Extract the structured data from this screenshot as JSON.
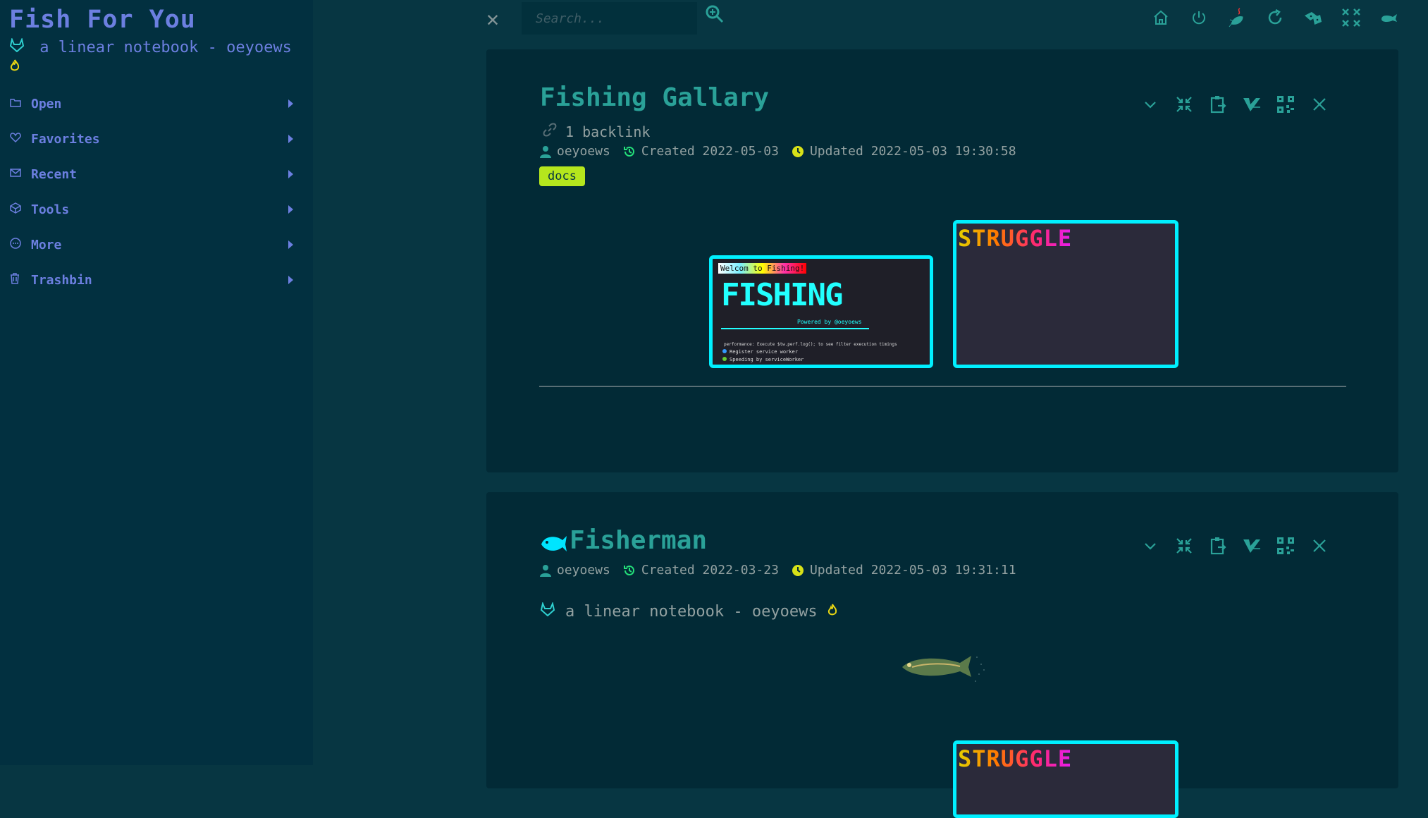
{
  "sidebar": {
    "title": "Fish For You",
    "subtitle": "a linear notebook - oeyoews",
    "menu": [
      {
        "label": "Open",
        "icon": "folder-icon"
      },
      {
        "label": "Favorites",
        "icon": "heart-icon"
      },
      {
        "label": "Recent",
        "icon": "mail-icon"
      },
      {
        "label": "Tools",
        "icon": "cube-icon"
      },
      {
        "label": "More",
        "icon": "ellipsis-icon"
      },
      {
        "label": "Trashbin",
        "icon": "trash-icon"
      }
    ]
  },
  "topbar": {
    "search_placeholder": "Search...",
    "icons": [
      "home-icon",
      "power-icon",
      "fish-hook-icon",
      "refresh-icon",
      "dice-icon",
      "grid-x-icon",
      "whale-icon"
    ]
  },
  "tiddlers": [
    {
      "title": "Fishing Gallary",
      "backlinks": "1 backlink",
      "author": "oeyoews",
      "created": "Created 2022-05-03",
      "updated": "Updated 2022-05-03 19:30:58",
      "tag": "docs",
      "gallery": {
        "image1": {
          "banner": "Welcom to Fishing!",
          "logo": "FISHING",
          "powered": "Powered by @oeyoews",
          "perf": "performance: Execute $tw.perf.log(); to see filter execution timings",
          "sw1": "Register service worker",
          "sw2": "Speeding by serviceWorker"
        },
        "image2": {
          "logo": "STRUGGLE"
        }
      }
    },
    {
      "title": "Fisherman",
      "author": "oeyoews",
      "created": "Created 2022-03-23",
      "updated": "Updated 2022-05-03 19:31:11",
      "body": "a linear notebook - oeyoews",
      "gallery": {
        "image2": {
          "logo": "STRUGGLE"
        }
      }
    }
  ],
  "colors": {
    "accent": "#2aa198",
    "sidebar_text": "#6c7fe0",
    "tag_bg": "#b5e61d",
    "frame": "#00f0ff"
  }
}
